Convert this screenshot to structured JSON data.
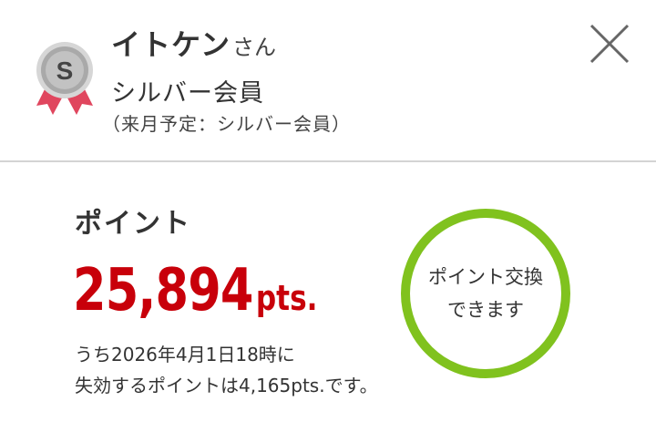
{
  "user": {
    "badge_letter": "S",
    "badge_icon": "silver-medal-icon",
    "name": "イトケン",
    "honorific": "さん",
    "rank": "シルバー会員",
    "next_month_rank": "（来月予定：シルバー会員）"
  },
  "close": {
    "icon": "close-icon"
  },
  "points": {
    "label": "ポイント",
    "value": "25,894",
    "unit": "pts.",
    "expire_line1": "うち2026年4月1日18時に",
    "expire_line2": "失効するポイントは4,165pts.です。"
  },
  "exchange": {
    "line1": "ポイント交換",
    "line2": "できます"
  },
  "colors": {
    "points_red": "#c8000a",
    "exchange_green": "#80c21e",
    "ribbon_pink": "#e0465e",
    "silver": "#a9a9a9"
  }
}
